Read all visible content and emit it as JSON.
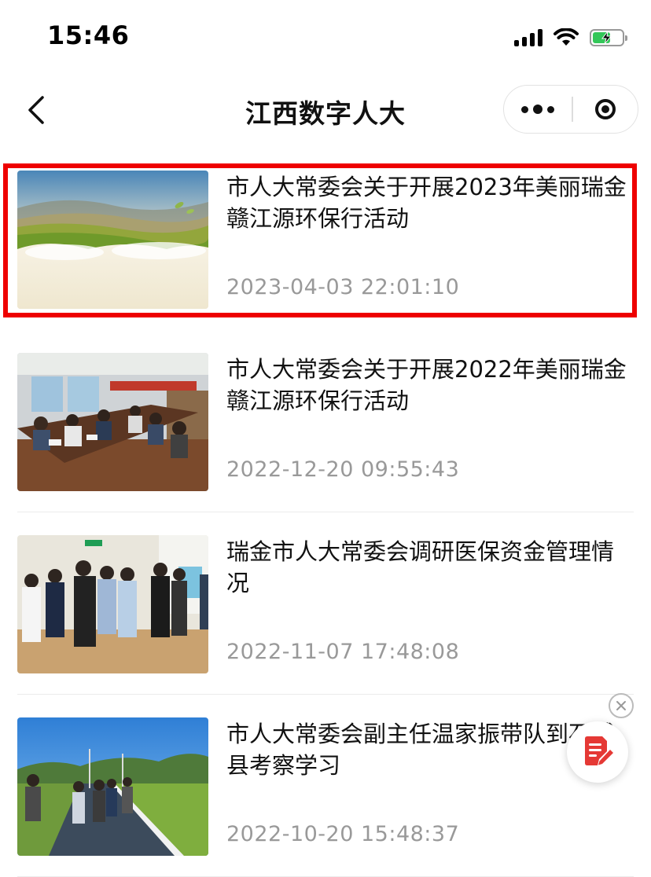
{
  "status_bar": {
    "time": "15:46"
  },
  "nav": {
    "title": "江西数字人大"
  },
  "colors": {
    "highlight": "#ee0000",
    "fab_accent": "#e53935",
    "battery": "#34c759"
  },
  "articles": [
    {
      "title": "市人大常委会关于开展2023年美丽瑞金赣江源环保行活动",
      "date": "2023-04-03 22:01:10",
      "thumbnail": "landscape-banner"
    },
    {
      "title": "市人大常委会关于开展2022年美丽瑞金赣江源环保行活动",
      "date": "2022-12-20 09:55:43",
      "thumbnail": "meeting-room-photo"
    },
    {
      "title": "瑞金市人大常委会调研医保资金管理情况",
      "date": "2022-11-07 17:48:08",
      "thumbnail": "hospital-visit-photo"
    },
    {
      "title": "市人大常委会副主任温家振带队到石城县考察学习",
      "date": "2022-10-20 15:48:37",
      "thumbnail": "field-visit-photo"
    }
  ],
  "icons": {
    "back": "chevron-left-icon",
    "more": "more-dots-icon",
    "close": "capsule-close-icon",
    "fab": "edit-document-icon",
    "fab_close": "close-circle-icon"
  }
}
